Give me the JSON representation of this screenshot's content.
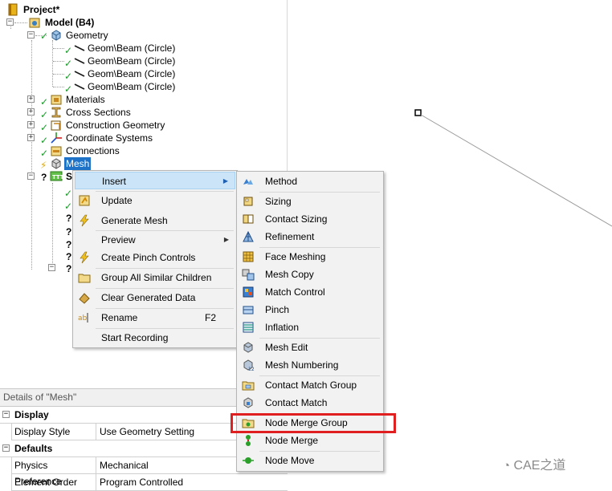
{
  "tree": {
    "project": "Project*",
    "model": "Model (B4)",
    "geometry": "Geometry",
    "bodies": [
      "Geom\\Beam (Circle)",
      "Geom\\Beam (Circle)",
      "Geom\\Beam (Circle)",
      "Geom\\Beam (Circle)"
    ],
    "materials": "Materials",
    "cross_sections": "Cross Sections",
    "construction_geometry": "Construction Geometry",
    "coordinate_systems": "Coordinate Systems",
    "connections": "Connections",
    "mesh": "Mesh",
    "static_partial": "S"
  },
  "context_menu": {
    "insert": "Insert",
    "update": "Update",
    "generate_mesh": "Generate Mesh",
    "preview": "Preview",
    "create_pinch_controls": "Create Pinch Controls",
    "group_all_similar_children": "Group All Similar Children",
    "clear_generated_data": "Clear Generated Data",
    "rename": "Rename",
    "rename_shortcut": "F2",
    "start_recording": "Start Recording"
  },
  "submenu": {
    "method": "Method",
    "sizing": "Sizing",
    "contact_sizing": "Contact Sizing",
    "refinement": "Refinement",
    "face_meshing": "Face Meshing",
    "mesh_copy": "Mesh Copy",
    "match_control": "Match Control",
    "pinch": "Pinch",
    "inflation": "Inflation",
    "mesh_edit": "Mesh Edit",
    "mesh_numbering": "Mesh Numbering",
    "contact_match_group": "Contact Match Group",
    "contact_match": "Contact Match",
    "node_merge_group": "Node Merge Group",
    "node_merge": "Node Merge",
    "node_move": "Node Move"
  },
  "details": {
    "title": "Details of \"Mesh\"",
    "section_display": "Display",
    "display_style_key": "Display Style",
    "display_style_value": "Use Geometry Setting",
    "section_defaults": "Defaults",
    "physics_preference_key": "Physics Preference",
    "physics_preference_value": "Mechanical",
    "element_order_key": "Element Order",
    "element_order_value": "Program Controlled"
  },
  "watermark": "CAE之道",
  "colors": {
    "highlight": "#e02020",
    "selection": "#1e73c9",
    "check": "#1d9a2c",
    "menu_bg": "#f2f2f2",
    "hover_bg": "#cce4f7"
  }
}
